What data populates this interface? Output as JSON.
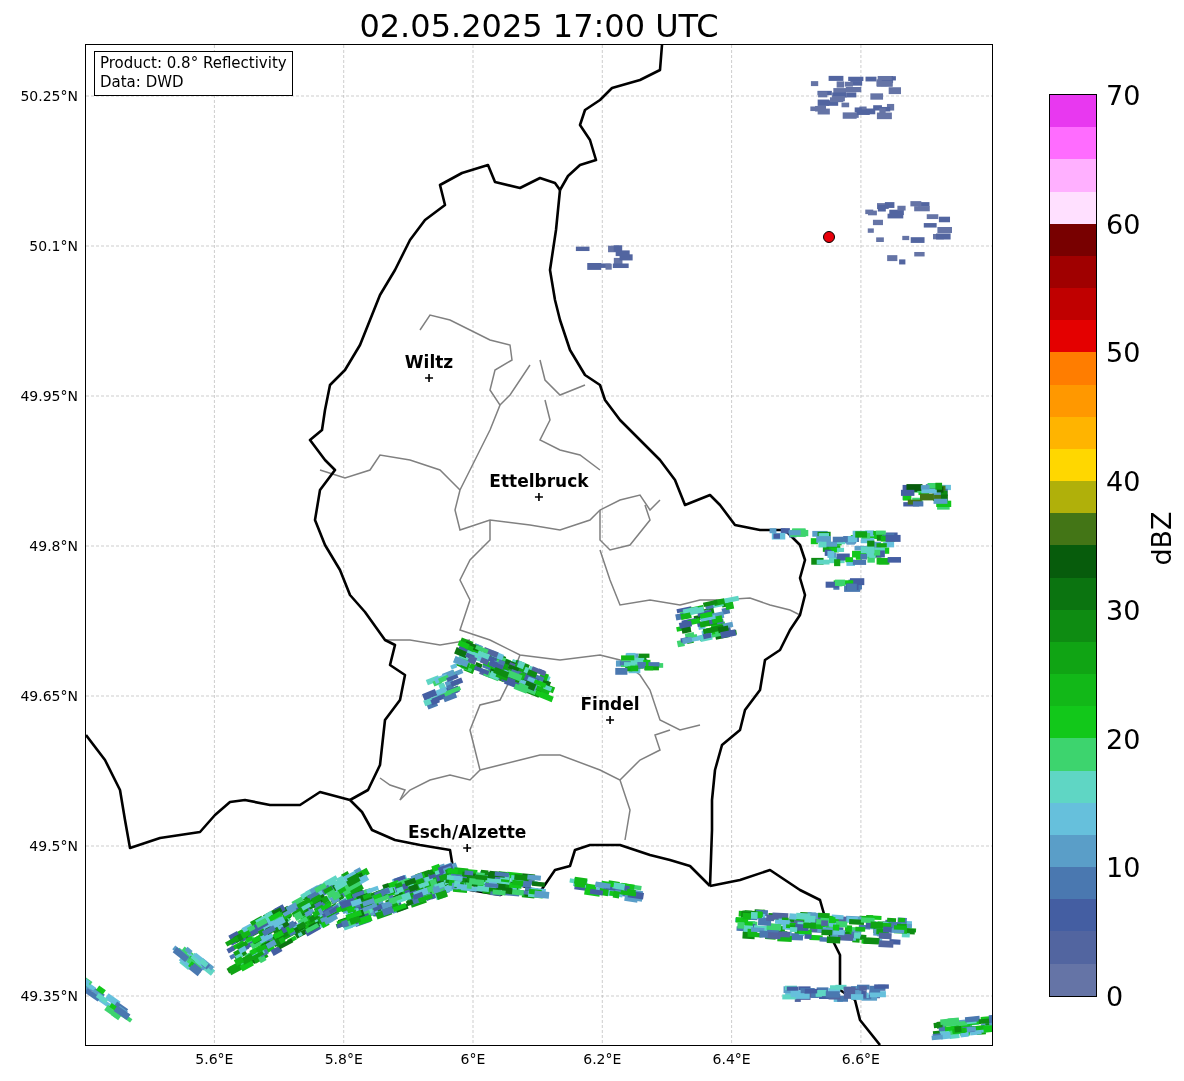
{
  "title": "02.05.2025 17:00 UTC",
  "info_box": {
    "lines": [
      "Product: 0.8° Reflectivity",
      "Data: DWD"
    ]
  },
  "map": {
    "xticks": [
      "5.6°E",
      "5.8°E",
      "6°E",
      "6.2°E",
      "6.4°E",
      "6.6°E"
    ],
    "yticks": [
      "50.25°N",
      "50.1°N",
      "49.95°N",
      "49.8°N",
      "49.65°N",
      "49.5°N",
      "49.35°N"
    ],
    "cities": [
      {
        "name": "Wiltz"
      },
      {
        "name": "Ettelbruck"
      },
      {
        "name": "Findel"
      },
      {
        "name": "Esch/Alzette"
      }
    ]
  },
  "colorbar": {
    "label": "dBZ",
    "ticks": [
      "70",
      "60",
      "50",
      "40",
      "30",
      "20",
      "10",
      "0"
    ],
    "bins": [
      {
        "color": "#e838f0"
      },
      {
        "color": "#ff6cff"
      },
      {
        "color": "#ffb0ff"
      },
      {
        "color": "#ffe0ff"
      },
      {
        "color": "#780000"
      },
      {
        "color": "#a00000"
      },
      {
        "color": "#c00000"
      },
      {
        "color": "#e40000"
      },
      {
        "color": "#ff7d00"
      },
      {
        "color": "#ff9800"
      },
      {
        "color": "#ffb400"
      },
      {
        "color": "#ffd700"
      },
      {
        "color": "#b0b00a"
      },
      {
        "color": "#437516"
      },
      {
        "color": "#075c0c"
      },
      {
        "color": "#0b7410"
      },
      {
        "color": "#0e8c12"
      },
      {
        "color": "#10a414"
      },
      {
        "color": "#12b818"
      },
      {
        "color": "#12c81a"
      },
      {
        "color": "#3dd46e"
      },
      {
        "color": "#5fd6c4"
      },
      {
        "color": "#66c0dc"
      },
      {
        "color": "#5a9ec8"
      },
      {
        "color": "#4a78b0"
      },
      {
        "color": "#445ea2"
      },
      {
        "color": "#5265a0"
      },
      {
        "color": "#6574a6"
      }
    ]
  }
}
